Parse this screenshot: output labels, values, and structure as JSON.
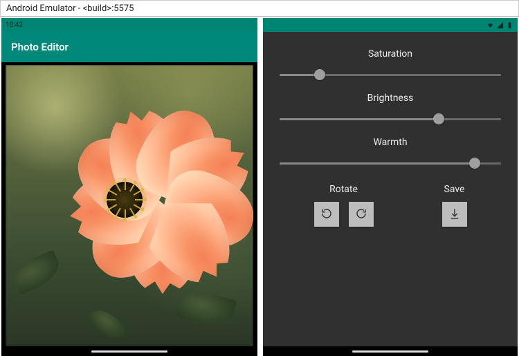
{
  "window": {
    "title": "Android Emulator - <build>:5575"
  },
  "status": {
    "time": "10:42"
  },
  "app": {
    "title": "Photo Editor"
  },
  "controls": {
    "saturation": {
      "label": "Saturation",
      "value": 18,
      "min": 0,
      "max": 100
    },
    "brightness": {
      "label": "Brightness",
      "value": 72,
      "min": 0,
      "max": 100
    },
    "warmth": {
      "label": "Warmth",
      "value": 88,
      "min": 0,
      "max": 100
    }
  },
  "actions": {
    "rotate": {
      "label": "Rotate"
    },
    "save": {
      "label": "Save"
    }
  },
  "icons": {
    "rotate_ccw": "rotate-ccw-icon",
    "rotate_cw": "rotate-cw-icon",
    "download": "download-icon",
    "wifi": "wifi-icon",
    "signal": "signal-icon",
    "battery": "battery-icon",
    "debug": "debug-icon"
  }
}
